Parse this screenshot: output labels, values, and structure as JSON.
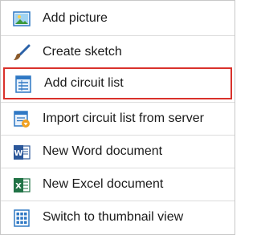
{
  "menu": {
    "items": [
      {
        "label": "Add picture",
        "icon": "picture-icon"
      },
      {
        "label": "Create sketch",
        "icon": "paintbrush-icon"
      },
      {
        "label": "Add circuit list",
        "icon": "list-table-icon",
        "highlighted": true
      },
      {
        "label": "Import circuit list from server",
        "icon": "import-list-icon"
      },
      {
        "label": "New Word document",
        "icon": "word-icon"
      },
      {
        "label": "New Excel document",
        "icon": "excel-icon"
      },
      {
        "label": "Switch to thumbnail view",
        "icon": "thumbnail-grid-icon"
      }
    ],
    "highlight_color": "#d9312b"
  }
}
